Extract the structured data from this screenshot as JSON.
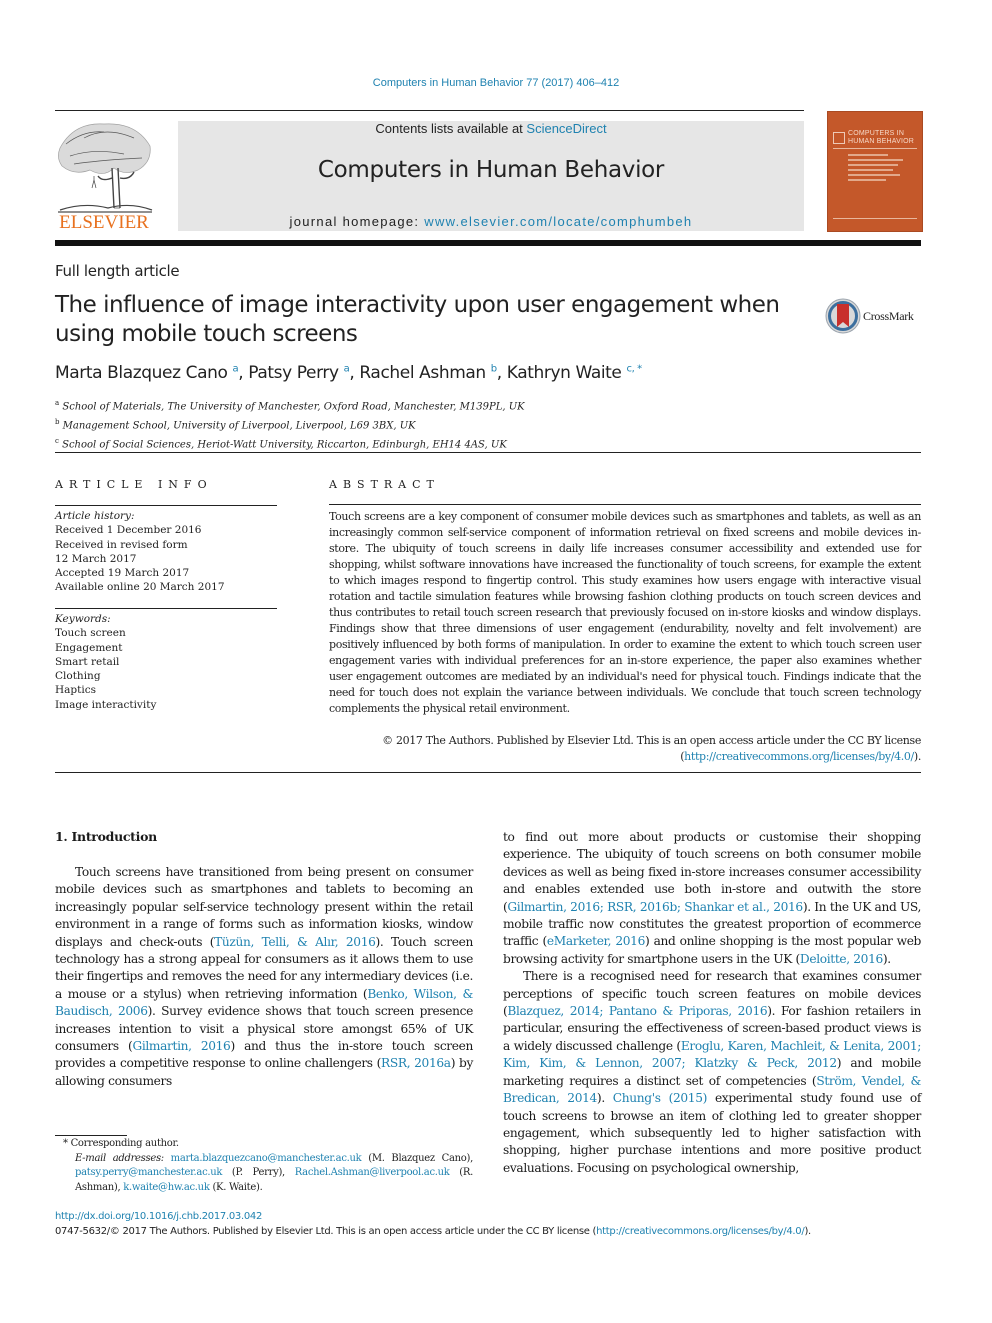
{
  "running_head": "Computers in Human Behavior 77 (2017) 406–412",
  "masthead": {
    "publisher_logo_text": "ELSEVIER",
    "contents_prefix": "Contents lists available at ",
    "contents_link": "ScienceDirect",
    "journal_title": "Computers in Human Behavior",
    "homepage_prefix": "journal homepage: ",
    "homepage_link": "www.elsevier.com/locate/comphumbeh",
    "cover_title_line1": "COMPUTERS IN",
    "cover_title_line2": "HUMAN BEHAVIOR",
    "cover_color": "#c4582a"
  },
  "article": {
    "type": "Full length article",
    "title": "The influence of image interactivity upon user engagement when using mobile touch screens",
    "crossmark_label": "CrossMark",
    "authors": [
      {
        "name": "Marta Blazquez Cano",
        "sup": "a"
      },
      {
        "name": "Patsy Perry",
        "sup": "a"
      },
      {
        "name": "Rachel Ashman",
        "sup": "b"
      },
      {
        "name": "Kathryn Waite",
        "sup": "c, *"
      }
    ],
    "affiliations": [
      {
        "sup": "a",
        "text": "School of Materials, The University of Manchester, Oxford Road, Manchester, M139PL, UK"
      },
      {
        "sup": "b",
        "text": "Management School, University of Liverpool, Liverpool, L69 3BX, UK"
      },
      {
        "sup": "c",
        "text": "School of Social Sciences, Heriot-Watt University, Riccarton, Edinburgh, EH14 4AS, UK"
      }
    ]
  },
  "article_info": {
    "heading": "ARTICLE INFO",
    "history_label": "Article history:",
    "history": [
      "Received 1 December 2016",
      "Received in revised form",
      "12 March 2017",
      "Accepted 19 March 2017",
      "Available online 20 March 2017"
    ],
    "keywords_label": "Keywords:",
    "keywords": [
      "Touch screen",
      "Engagement",
      "Smart retail",
      "Clothing",
      "Haptics",
      "Image interactivity"
    ]
  },
  "abstract": {
    "heading": "ABSTRACT",
    "text": "Touch screens are a key component of consumer mobile devices such as smartphones and tablets, as well as an increasingly common self-service component of information retrieval on fixed screens and mobile devices in-store. The ubiquity of touch screens in daily life increases consumer accessibility and extended use for shopping, whilst software innovations have increased the functionality of touch screens, for example the extent to which images respond to fingertip control. This study examines how users engage with interactive visual rotation and tactile simulation features while browsing fashion clothing products on touch screen devices and thus contributes to retail touch screen research that previously focused on in-store kiosks and window displays. Findings show that three dimensions of user engagement (endurability, novelty and felt involvement) are positively influenced by both forms of manipulation. In order to examine the extent to which touch screen user engagement varies with individual preferences for an in-store experience, the paper also examines whether user engagement outcomes are mediated by an individual's need for physical touch. Findings indicate that the need for touch does not explain the variance between individuals. We conclude that touch screen technology complements the physical retail environment.",
    "copyright": "© 2017 The Authors. Published by Elsevier Ltd. This is an open access article under the CC BY license",
    "license_link": "http://creativecommons.org/licenses/by/4.0/"
  },
  "body": {
    "section_heading": "1.  Introduction",
    "left_col": [
      {
        "t": "Touch screens have transitioned from being present on consumer mobile devices such as smartphones and tablets to becoming an increasingly popular self-service technology present within the retail environment in a range of forms such as information kiosks, window displays and check-outs ("
      },
      {
        "l": "Tüzün, Telli, & Alır, 2016"
      },
      {
        "t": "). Touch screen technology has a strong appeal for consumers as it allows them to use their fingertips and removes the need for any intermediary devices (i.e. a mouse or a stylus) when retrieving information ("
      },
      {
        "l": "Benko, Wilson, & Baudisch, 2006"
      },
      {
        "t": "). Survey evidence shows that touch screen presence increases intention to visit a physical store amongst 65% of UK consumers ("
      },
      {
        "l": "Gilmartin, 2016"
      },
      {
        "t": ") and thus the in-store touch screen provides a competitive response to online challengers ("
      },
      {
        "l": "RSR, 2016a"
      },
      {
        "t": ") by allowing consumers"
      }
    ],
    "right_p1": [
      {
        "t": "to find out more about products or customise their shopping experience. The ubiquity of touch screens on both consumer mobile devices as well as being fixed in-store increases consumer accessibility and enables extended use both in-store and outwith the store ("
      },
      {
        "l": "Gilmartin, 2016; RSR, 2016b; Shankar et al., 2016"
      },
      {
        "t": "). In the UK and US, mobile traffic now constitutes the greatest proportion of ecommerce traffic ("
      },
      {
        "l": "eMarketer, 2016"
      },
      {
        "t": ") and online shopping is the most popular web browsing activity for smartphone users in the UK ("
      },
      {
        "l": "Deloitte, 2016"
      },
      {
        "t": ")."
      }
    ],
    "right_p2": [
      {
        "t": "There is a recognised need for research that examines consumer perceptions of specific touch screen features on mobile devices ("
      },
      {
        "l": "Blazquez, 2014; Pantano & Priporas, 2016"
      },
      {
        "t": "). For fashion retailers in particular, ensuring the effectiveness of screen-based product views is a widely discussed challenge ("
      },
      {
        "l": "Eroglu, Karen, Machleit, & Lenita, 2001; Kim, Kim, & Lennon, 2007; Klatzky & Peck, 2012"
      },
      {
        "t": ") and mobile marketing requires a distinct set of competencies ("
      },
      {
        "l": "Ström, Vendel, & Bredican, 2014"
      },
      {
        "t": "). "
      },
      {
        "l": "Chung's (2015)"
      },
      {
        "t": " experimental study found use of touch screens to browse an item of clothing led to greater shopper engagement, which subsequently led to higher satisfaction with shopping, higher purchase intentions and more positive product evaluations. Focusing on psychological ownership,"
      }
    ]
  },
  "footnote": {
    "corresponding": "* Corresponding author.",
    "email_label": "E-mail addresses:",
    "emails": [
      {
        "addr": "marta.blazquezcano@manchester.ac.uk",
        "who": " (M. Blazquez Cano), "
      },
      {
        "addr": "patsy.perry@manchester.ac.uk",
        "who": " (P. Perry), "
      },
      {
        "addr": "Rachel.Ashman@liverpool.ac.uk",
        "who": " (R. Ashman), "
      },
      {
        "addr": "k.waite@hw.ac.uk",
        "who": " (K. Waite)."
      }
    ]
  },
  "footer": {
    "doi": "http://dx.doi.org/10.1016/j.chb.2017.03.042",
    "issn_text": "0747-5632/© 2017 The Authors. Published by Elsevier Ltd. This is an open access article under the CC BY license (",
    "license_link": "http://creativecommons.org/licenses/by/4.0/",
    "issn_close": ")."
  },
  "colors": {
    "link": "#1f82b0",
    "elsevier_orange": "#e8711f",
    "banner_bg": "#e6e6e6"
  }
}
